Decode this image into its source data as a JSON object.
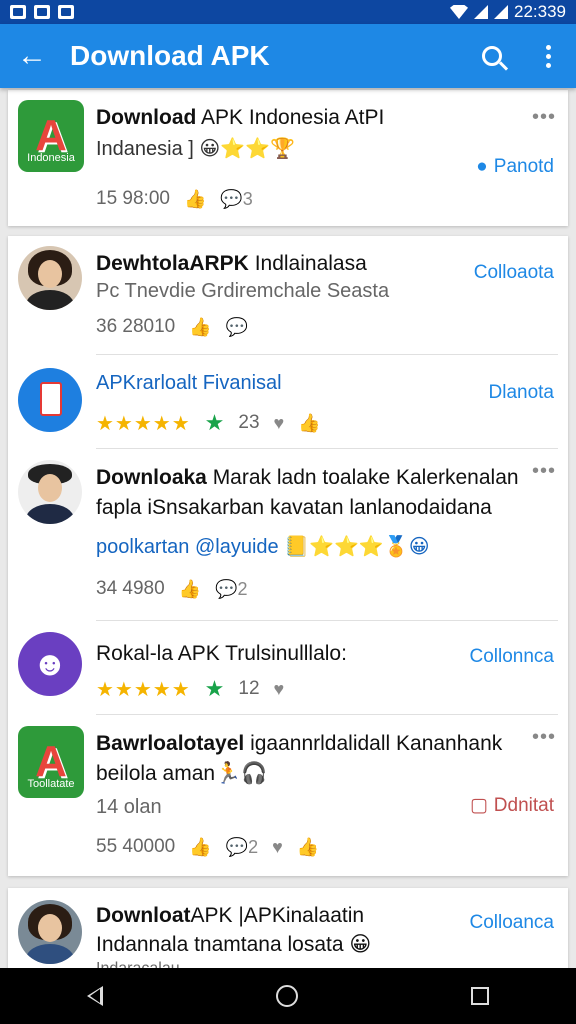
{
  "status_bar": {
    "time": "22:339"
  },
  "app_bar": {
    "back_glyph": "←",
    "title": "Download APK"
  },
  "cards": [
    {
      "icon_caption": "Indonesia",
      "title_bold": "Download",
      "title_rest": " APK Indonesia AtPI",
      "line2": "Indanesia  ]",
      "line2_emoji": "😀⭐⭐🏆",
      "action": "Panotd",
      "stats_views": "15  98:00",
      "stats_likes": "👍",
      "stats_comments": "💬3"
    }
  ],
  "list": [
    {
      "title_bold": "DewhtolaARPK",
      "title_rest": " Indlainalasa",
      "line2": "Pc Tnevdie Grdiremchale Seasta",
      "action": "Colloaota",
      "stats_views": "36  28010",
      "stats_likes": "👍",
      "stats_comments": "💬"
    },
    {
      "title": "APKrarloalt Fivanisal",
      "action": "Dlanota",
      "rating": "23",
      "stars": "★★★★★"
    },
    {
      "title_bold": "Downloaka",
      "title_rest": " Marak ladn toalake Kalerkenalan",
      "line2": "fapla iSnsakarban kavatan lanlanodaidana",
      "line3": "poolkartan @layuide",
      "line3_emoji": "📒⭐⭐⭐🏅😀",
      "stats_views": "34  4980",
      "stats_likes": "👍",
      "stats_comments": "💬2"
    },
    {
      "title": "Rokal-la APK Trulsinulllalo:",
      "action": "Collonnca",
      "rating": "12",
      "stars": "★★★★★"
    },
    {
      "title_bold": "Bawrloalotayel",
      "title_rest": " igaannrldalidall Kananhank",
      "line2": "beilola aman",
      "line2_emoji": "🏃🎧",
      "line3": "14 olan",
      "action": "Ddnitat",
      "icon_caption": "Toollatate",
      "stats_views": "55  40000",
      "stats_likes": "👍",
      "stats_comments": "💬2"
    }
  ],
  "last_card": {
    "title_bold": "Downloat",
    "title_rest": "APK |APKinalaatin",
    "line2": "Indannala tnamtana losata",
    "line2_emoji": "😀",
    "action": "Colloanca",
    "peek": "Indaracalau"
  },
  "icons": {
    "more": "•••",
    "heart": "♥",
    "thumbs": "👍",
    "star": "★"
  },
  "colors": {
    "appbar": "#1e88e5",
    "statusbar": "#0d47a1",
    "link": "#1e88e5"
  }
}
